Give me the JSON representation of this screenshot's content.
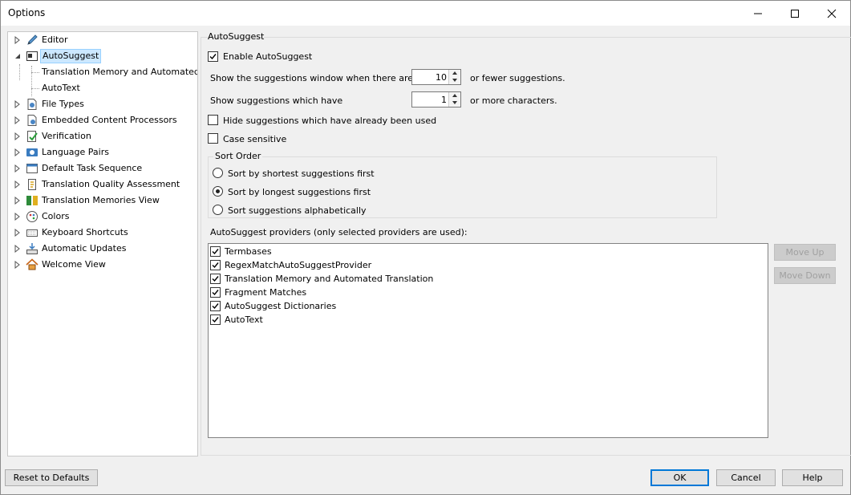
{
  "window": {
    "title": "Options"
  },
  "tree": {
    "items": [
      {
        "label": "Editor",
        "icon": "pencil-icon"
      },
      {
        "label": "AutoSuggest",
        "icon": "autosuggest-icon",
        "selected": true,
        "expanded": true
      },
      {
        "label": "Translation Memory and Automated Tr",
        "child": true
      },
      {
        "label": "AutoText",
        "child": true
      },
      {
        "label": "File Types",
        "icon": "file-types-icon"
      },
      {
        "label": "Embedded Content Processors",
        "icon": "embedded-content-icon"
      },
      {
        "label": "Verification",
        "icon": "verification-icon"
      },
      {
        "label": "Language Pairs",
        "icon": "language-pairs-icon"
      },
      {
        "label": "Default Task Sequence",
        "icon": "task-sequence-icon"
      },
      {
        "label": "Translation Quality Assessment",
        "icon": "quality-assessment-icon"
      },
      {
        "label": "Translation Memories View",
        "icon": "tm-view-icon"
      },
      {
        "label": "Colors",
        "icon": "palette-icon"
      },
      {
        "label": "Keyboard Shortcuts",
        "icon": "keyboard-icon"
      },
      {
        "label": "Automatic Updates",
        "icon": "updates-icon"
      },
      {
        "label": "Welcome View",
        "icon": "home-icon"
      }
    ]
  },
  "autosuggest": {
    "group_title": "AutoSuggest",
    "enable_label": "Enable AutoSuggest",
    "enable_checked": true,
    "show_window_label": "Show the suggestions window when there are",
    "show_window_value": "10",
    "show_window_suffix": "or fewer suggestions.",
    "min_chars_label": "Show suggestions which have",
    "min_chars_value": "1",
    "min_chars_suffix": "or more characters.",
    "hide_used_label": "Hide suggestions which have already been used",
    "hide_used_checked": false,
    "case_label": "Case sensitive",
    "case_checked": false,
    "sort_order_label": "Sort Order",
    "sort_options": [
      {
        "label": "Sort by shortest suggestions first",
        "selected": false
      },
      {
        "label": "Sort by longest suggestions first",
        "selected": true
      },
      {
        "label": "Sort suggestions alphabetically",
        "selected": false
      }
    ],
    "providers_label": "AutoSuggest providers (only selected providers are used):",
    "providers": [
      {
        "label": "Termbases",
        "checked": true
      },
      {
        "label": "RegexMatchAutoSuggestProvider",
        "checked": true
      },
      {
        "label": "Translation Memory and Automated Translation",
        "checked": true
      },
      {
        "label": "Fragment Matches",
        "checked": true
      },
      {
        "label": "AutoSuggest Dictionaries",
        "checked": true
      },
      {
        "label": "AutoText",
        "checked": true
      }
    ],
    "move_up_label": "Move Up",
    "move_down_label": "Move Down"
  },
  "footer": {
    "reset_label": "Reset to Defaults",
    "ok_label": "OK",
    "cancel_label": "Cancel",
    "help_label": "Help"
  },
  "colors": {
    "selection": "#cce8ff",
    "accent": "#0078d7"
  }
}
